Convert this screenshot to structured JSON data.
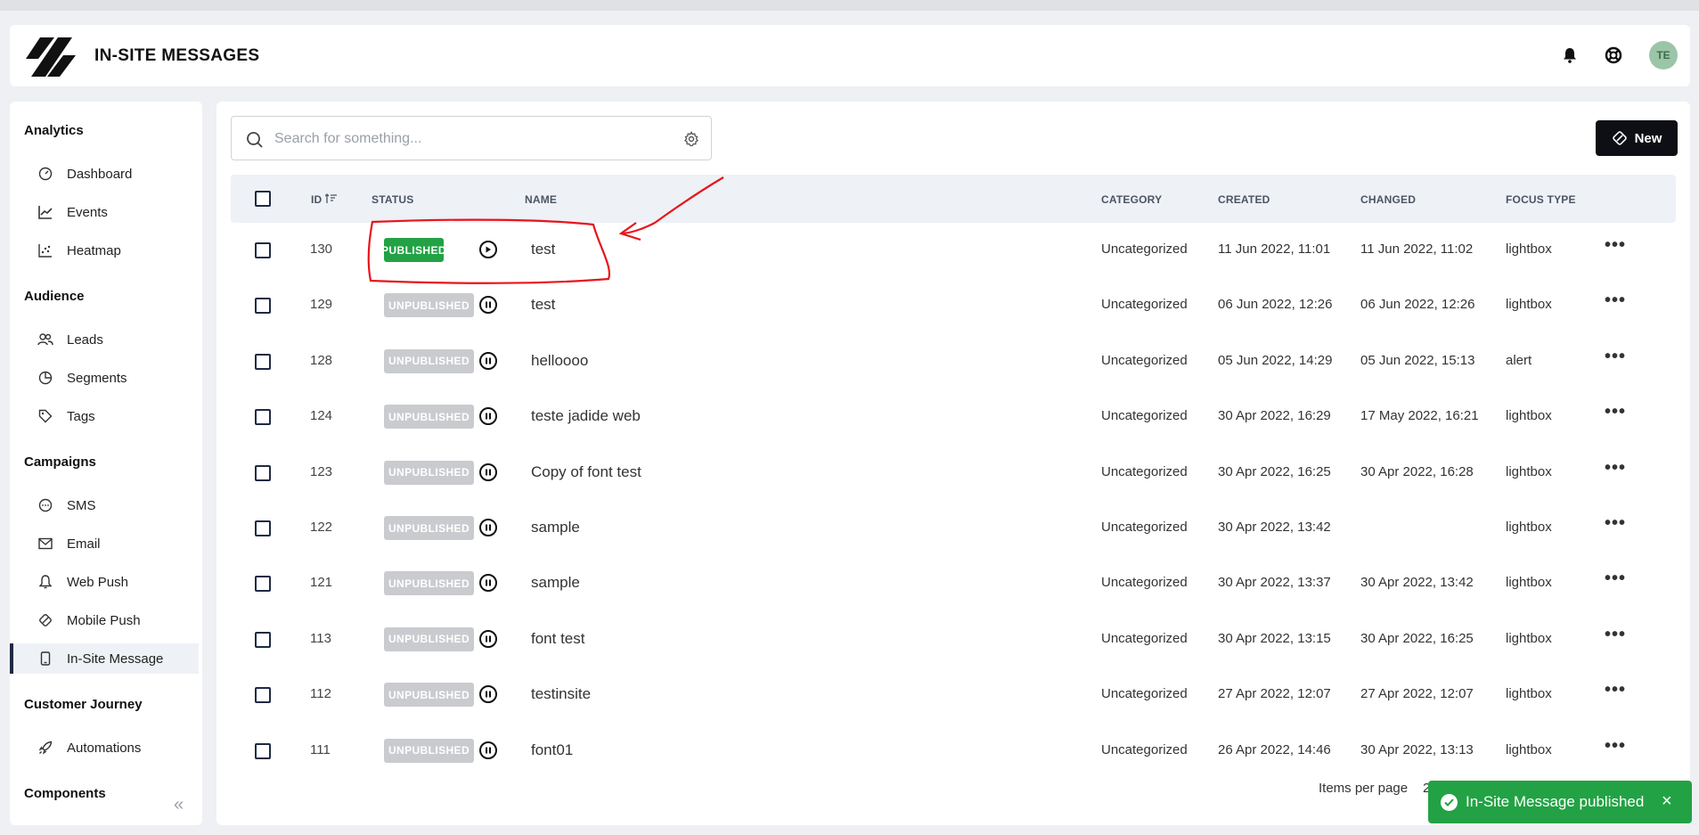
{
  "app": {
    "title": "IN-SITE MESSAGES",
    "logo_icon": "brand-logo-icon",
    "avatar_initials": "TE"
  },
  "header": {
    "icons": [
      "bell-icon",
      "help-lifebuoy-icon"
    ]
  },
  "sidebar": {
    "sections": [
      {
        "title": "Analytics",
        "items": [
          {
            "label": "Dashboard",
            "icon": "dashboard-gauge-icon"
          },
          {
            "label": "Events",
            "icon": "line-chart-icon"
          },
          {
            "label": "Heatmap",
            "icon": "scatter-chart-icon"
          }
        ]
      },
      {
        "title": "Audience",
        "items": [
          {
            "label": "Leads",
            "icon": "users-icon"
          },
          {
            "label": "Segments",
            "icon": "pie-chart-icon"
          },
          {
            "label": "Tags",
            "icon": "tag-icon"
          }
        ]
      },
      {
        "title": "Campaigns",
        "items": [
          {
            "label": "SMS",
            "icon": "chat-bubble-icon"
          },
          {
            "label": "Email",
            "icon": "envelope-icon"
          },
          {
            "label": "Web Push",
            "icon": "bell-icon"
          },
          {
            "label": "Mobile Push",
            "icon": "badge-icon"
          },
          {
            "label": "In-Site Message",
            "icon": "mobile-icon",
            "active": true
          }
        ]
      },
      {
        "title": "Customer Journey",
        "items": [
          {
            "label": "Automations",
            "icon": "rocket-icon"
          }
        ]
      },
      {
        "title": "Components",
        "items": []
      }
    ]
  },
  "toolbar": {
    "search_placeholder": "Search for something...",
    "new_label": "New"
  },
  "table": {
    "columns": {
      "id": "ID",
      "status": "STATUS",
      "name": "NAME",
      "category": "CATEGORY",
      "created": "CREATED",
      "changed": "CHANGED",
      "focus_type": "FOCUS TYPE"
    },
    "rows": [
      {
        "id": "130",
        "status": "PUBLISHED",
        "name": "test",
        "category": "Uncategorized",
        "created": "11 Jun 2022, 11:01",
        "changed": "11 Jun 2022, 11:02",
        "focus_type": "lightbox"
      },
      {
        "id": "129",
        "status": "UNPUBLISHED",
        "name": "test",
        "category": "Uncategorized",
        "created": "06 Jun 2022, 12:26",
        "changed": "06 Jun 2022, 12:26",
        "focus_type": "lightbox"
      },
      {
        "id": "128",
        "status": "UNPUBLISHED",
        "name": "helloooo",
        "category": "Uncategorized",
        "created": "05 Jun 2022, 14:29",
        "changed": "05 Jun 2022, 15:13",
        "focus_type": "alert"
      },
      {
        "id": "124",
        "status": "UNPUBLISHED",
        "name": "teste jadide web",
        "category": "Uncategorized",
        "created": "30 Apr 2022, 16:29",
        "changed": "17 May 2022, 16:21",
        "focus_type": "lightbox"
      },
      {
        "id": "123",
        "status": "UNPUBLISHED",
        "name": "Copy of font test",
        "category": "Uncategorized",
        "created": "30 Apr 2022, 16:25",
        "changed": "30 Apr 2022, 16:28",
        "focus_type": "lightbox"
      },
      {
        "id": "122",
        "status": "UNPUBLISHED",
        "name": "sample",
        "category": "Uncategorized",
        "created": "30 Apr 2022, 13:42",
        "changed": "",
        "focus_type": "lightbox"
      },
      {
        "id": "121",
        "status": "UNPUBLISHED",
        "name": "sample",
        "category": "Uncategorized",
        "created": "30 Apr 2022, 13:37",
        "changed": "30 Apr 2022, 13:42",
        "focus_type": "lightbox"
      },
      {
        "id": "113",
        "status": "UNPUBLISHED",
        "name": "font test",
        "category": "Uncategorized",
        "created": "30 Apr 2022, 13:15",
        "changed": "30 Apr 2022, 16:25",
        "focus_type": "lightbox"
      },
      {
        "id": "112",
        "status": "UNPUBLISHED",
        "name": "testinsite",
        "category": "Uncategorized",
        "created": "27 Apr 2022, 12:07",
        "changed": "27 Apr 2022, 12:07",
        "focus_type": "lightbox"
      },
      {
        "id": "111",
        "status": "UNPUBLISHED",
        "name": "font01",
        "category": "Uncategorized",
        "created": "26 Apr 2022, 14:46",
        "changed": "30 Apr 2022, 13:13",
        "focus_type": "lightbox"
      }
    ]
  },
  "pagination": {
    "items_per_page_label": "Items per page",
    "items_per_page_value": "2"
  },
  "toast": {
    "message": "In-Site Message published",
    "close": "×"
  },
  "colors": {
    "published": "#22a244",
    "unpublished": "#c9cbcf",
    "annotation": "#e8141b",
    "primary_dark": "#0d0f14"
  }
}
